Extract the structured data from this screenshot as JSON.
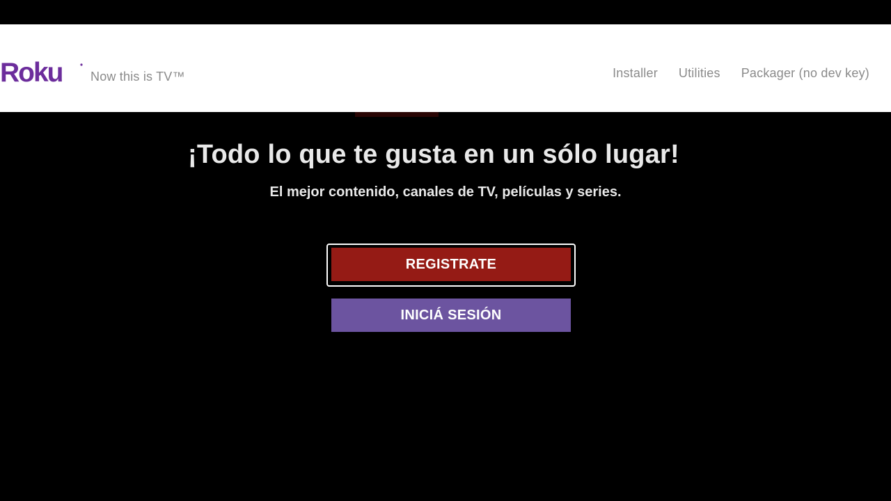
{
  "header": {
    "logo_text": "Roku",
    "tagline": "Now this is TV™",
    "nav": [
      {
        "label": "Installer"
      },
      {
        "label": "Utilities"
      },
      {
        "label": "Packager (no dev key)"
      }
    ]
  },
  "screen": {
    "headline": "¡Todo lo que te gusta en un sólo lugar!",
    "subheadline": "El mejor contenido, canales de TV, películas y series.",
    "buttons": {
      "register": "REGISTRATE",
      "login": "INICIÁ SESIÓN"
    }
  },
  "colors": {
    "background": "#000000",
    "header_bg": "#ffffff",
    "roku_purple": "#6c2d9c",
    "register_button": "#951b15",
    "login_button": "#6c54a0",
    "focus_ring": "#ffffff",
    "text_primary": "#e9e9e9",
    "nav_text": "#8a8a8a"
  }
}
